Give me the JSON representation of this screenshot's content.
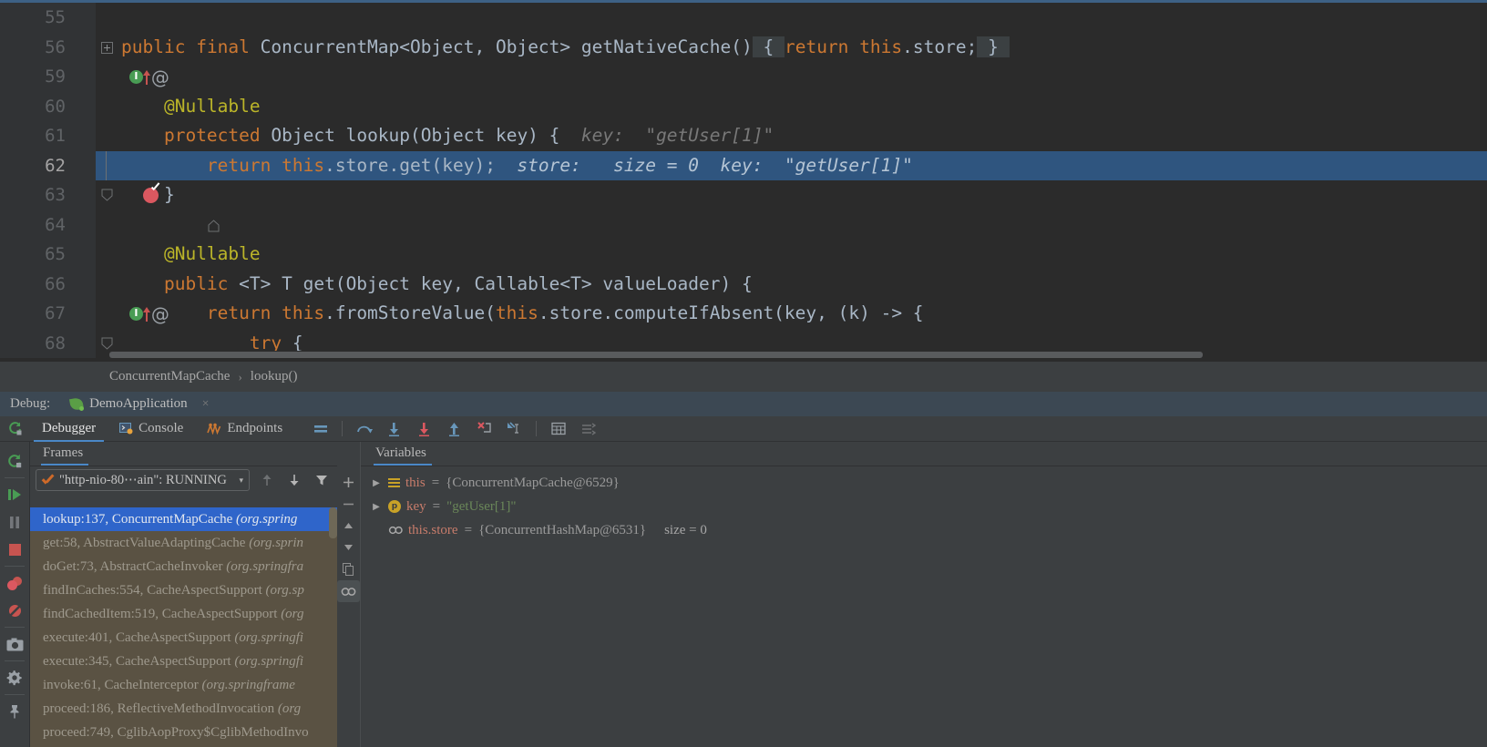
{
  "editor": {
    "font_size": "19.5px",
    "lines": [
      {
        "no": "55",
        "gutter": [],
        "fold": "",
        "text_html": "",
        "current": false
      },
      {
        "no": "56",
        "gutter": [
          "impl-arrow-icon",
          "override-arrow-icon",
          "annotation-at-icon"
        ],
        "fold": "plus",
        "code": "public final ConcurrentMap<Object, Object> getNativeCache() { return this.store; }",
        "current": false
      },
      {
        "no": "59",
        "gutter": [],
        "fold": "",
        "code": "",
        "current": false
      },
      {
        "no": "60",
        "gutter": [],
        "fold": "",
        "code": "    @Nullable",
        "current": false
      },
      {
        "no": "61",
        "gutter": [
          "impl-arrow-icon",
          "override-arrow-icon"
        ],
        "fold": "chevron",
        "code": "    protected Object lookup(Object key) {",
        "inline": "key:  \"getUser[1]\"",
        "current": false
      },
      {
        "no": "62",
        "gutter": [
          "breakpoint-verified-icon"
        ],
        "fold": "",
        "code": "        return this.store.get(key);",
        "inline": "store:   size = 0   key:  \"getUser[1]\"",
        "current": true
      },
      {
        "no": "63",
        "gutter": [],
        "fold": "end",
        "code": "    }",
        "current": false
      },
      {
        "no": "64",
        "gutter": [],
        "fold": "",
        "code": "",
        "current": false
      },
      {
        "no": "65",
        "gutter": [],
        "fold": "",
        "code": "    @Nullable",
        "current": false
      },
      {
        "no": "66",
        "gutter": [
          "impl-arrow-icon",
          "override-arrow-icon",
          "annotation-at-icon"
        ],
        "fold": "chevron",
        "code": "    public <T> T get(Object key, Callable<T> valueLoader) {",
        "current": false
      },
      {
        "no": "67",
        "gutter": [],
        "fold": "chevron",
        "code": "        return this.fromStoreValue(this.store.computeIfAbsent(key, (k) -> {",
        "current": false
      },
      {
        "no": "68",
        "gutter": [],
        "fold": "chevron",
        "code": "            try {",
        "current": false
      }
    ],
    "inline_line61": "key:  \"getUser[1]\"",
    "inline_line62_store": "store:   size = 0",
    "inline_line62_key": "key:  \"getUser[1]\"",
    "colors": {
      "background": "#2b2b2b",
      "gutter": "#313335",
      "current_line": "#2f557f",
      "keyword": "#cc7832",
      "string": "#6a8759",
      "annotation": "#bbb529",
      "default_text": "#a9b7c6"
    }
  },
  "breadcrumb": {
    "class": "ConcurrentMapCache",
    "separator": "›",
    "method": "lookup()"
  },
  "debug_header": {
    "label": "Debug:",
    "run_config": "DemoApplication",
    "close": "×"
  },
  "debug_toolbar": {
    "rerun_title": "Rerun",
    "tabs": [
      {
        "label": "Debugger",
        "active": true
      },
      {
        "label": "Console",
        "active": false
      },
      {
        "label": "Endpoints",
        "active": false
      }
    ],
    "step_buttons": [
      "show-execution-point-icon",
      "step-over-icon",
      "step-into-icon",
      "force-step-into-icon",
      "step-out-icon",
      "drop-frame-icon",
      "run-to-cursor-icon",
      "evaluate-expression-icon",
      "settings-icon"
    ]
  },
  "left_strip": {
    "buttons": [
      "rerun-icon",
      "resume-program-icon",
      "pause-program-icon",
      "stop-icon",
      "view-breakpoints-icon",
      "mute-breakpoints-icon",
      "screenshot-icon",
      "settings-gear-icon",
      "pin-tab-icon"
    ]
  },
  "frames": {
    "tab_label": "Frames",
    "thread": {
      "name": "\"http-nio-80⋯ain\": RUNNING",
      "status_icon": "running-check-icon",
      "caret": "▾"
    },
    "toolbar_icons": [
      "frame-up-icon",
      "frame-down-icon",
      "filter-icon"
    ],
    "items": [
      {
        "method": "lookup:137, ConcurrentMapCache ",
        "pkg": "(org.spring",
        "selected": true
      },
      {
        "method": "get:58, AbstractValueAdaptingCache ",
        "pkg": "(org.sprin",
        "selected": false
      },
      {
        "method": "doGet:73, AbstractCacheInvoker ",
        "pkg": "(org.springfra",
        "selected": false
      },
      {
        "method": "findInCaches:554, CacheAspectSupport ",
        "pkg": "(org.sp",
        "selected": false
      },
      {
        "method": "findCachedItem:519, CacheAspectSupport ",
        "pkg": "(org",
        "selected": false
      },
      {
        "method": "execute:401, CacheAspectSupport ",
        "pkg": "(org.springfi",
        "selected": false
      },
      {
        "method": "execute:345, CacheAspectSupport ",
        "pkg": "(org.springfi",
        "selected": false
      },
      {
        "method": "invoke:61, CacheInterceptor ",
        "pkg": "(org.springframe",
        "selected": false
      },
      {
        "method": "proceed:186, ReflectiveMethodInvocation ",
        "pkg": "(org",
        "selected": false
      },
      {
        "method": "proceed:749, CglibAopProxy$CglibMethodInvo",
        "pkg": "",
        "selected": false
      }
    ]
  },
  "variables": {
    "tab_label": "Variables",
    "toolbar": {
      "add": "+",
      "remove": "−",
      "up": "▲",
      "down": "▼",
      "copy": "copy-icon",
      "chain": "∞"
    },
    "rows": [
      {
        "twisty": "▶",
        "icon": "field-icon",
        "name": "this",
        "eq": "=",
        "value": "{ConcurrentMapCache@6529}",
        "extra": "",
        "value_kind": "object",
        "indent": 0
      },
      {
        "twisty": "▶",
        "icon": "parameter-icon",
        "name": "key",
        "eq": "=",
        "value": "\"getUser[1]\"",
        "extra": "",
        "value_kind": "string",
        "indent": 0
      },
      {
        "twisty": "",
        "icon": "chain-icon",
        "name": "this.store",
        "eq": "=",
        "value": "{ConcurrentHashMap@6531}",
        "extra": "size = 0",
        "value_kind": "object",
        "indent": 1
      }
    ]
  }
}
